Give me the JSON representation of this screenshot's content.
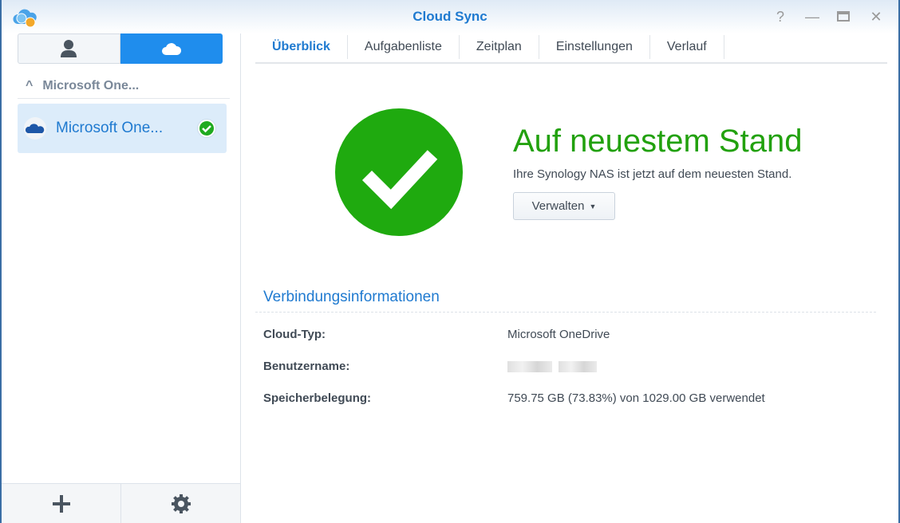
{
  "window": {
    "title": "Cloud Sync",
    "help_icon": "question-icon",
    "minimize_icon": "minimize-icon",
    "maximize_icon": "maximize-icon",
    "close_icon": "close-icon"
  },
  "sidebar": {
    "group_label": "Microsoft One...",
    "items": [
      {
        "label": "Microsoft One...",
        "status": "synced"
      }
    ]
  },
  "tabs": [
    {
      "label": "Überblick"
    },
    {
      "label": "Aufgabenliste"
    },
    {
      "label": "Zeitplan"
    },
    {
      "label": "Einstellungen"
    },
    {
      "label": "Verlauf"
    }
  ],
  "overview": {
    "status_title": "Auf neuestem Stand",
    "status_text": "Ihre Synology NAS ist jetzt auf dem neuesten Stand.",
    "manage_label": "Verwalten"
  },
  "connection": {
    "heading": "Verbindungsinformationen",
    "rows": [
      {
        "label": "Cloud-Typ:",
        "value": "Microsoft OneDrive"
      },
      {
        "label": "Benutzername:"
      },
      {
        "label": "Speicherbelegung:",
        "value": "759.75 GB (73.83%) von 1029.00 GB verwendet"
      }
    ]
  },
  "colors": {
    "accent": "#1f7ad0",
    "success": "#1faa0f"
  }
}
